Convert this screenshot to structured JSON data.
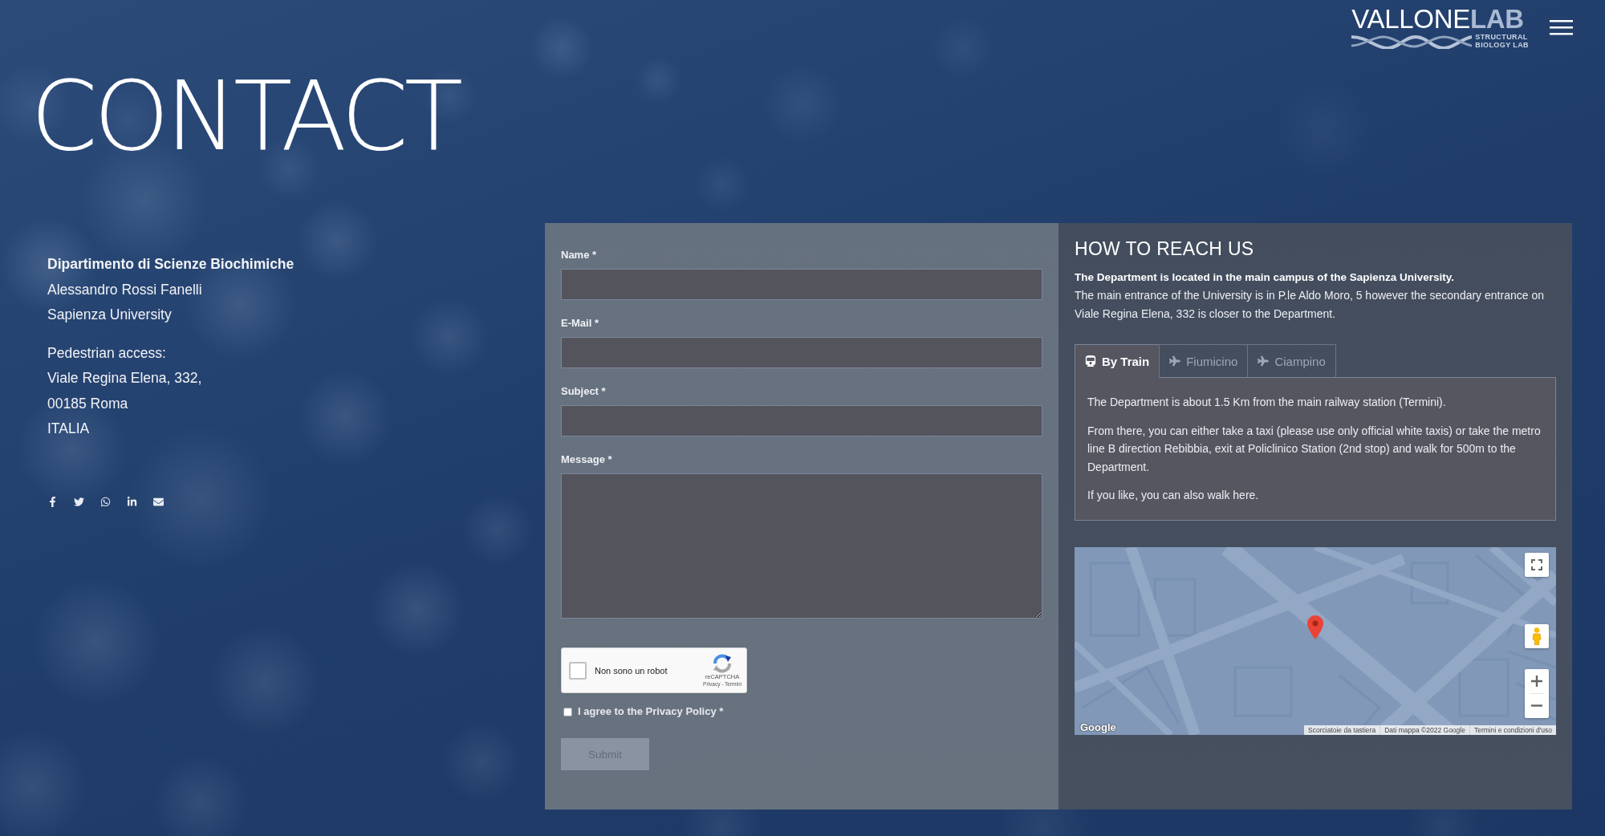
{
  "header": {
    "logo": {
      "wordmark": "VALLONE**LAB**",
      "tagline": [
        "STRUCTURAL",
        "BIOLOGY LAB"
      ]
    }
  },
  "page_title": "CONTACT",
  "address": {
    "heading": "Dipartimento di Scienze Biochimiche",
    "lines": [
      "Alessandro Rossi Fanelli",
      "Sapienza University"
    ]
  },
  "access": {
    "lines": [
      "Pedestrian access:",
      "Viale Regina Elena, 332,",
      "00185 Roma",
      "ITALIA"
    ]
  },
  "form": {
    "fields": [
      {
        "label": "Name *",
        "kind": "input"
      },
      {
        "label": "E-Mail *",
        "kind": "input"
      },
      {
        "label": "Subject *",
        "kind": "input"
      },
      {
        "label": "Message *",
        "kind": "textarea"
      }
    ],
    "recaptcha": {
      "label": "Non sono un robot",
      "checked": false,
      "brand": "reCAPTCHA",
      "links": "Privacy - Termini"
    },
    "consent": {
      "label": "I agree to the Privacy Policy *",
      "checked": false
    },
    "submit": {
      "label": "Submit",
      "disabled": true
    }
  },
  "directions": {
    "title": "HOW TO REACH US",
    "lead": "The Department is located in the main campus of the Sapienza University.",
    "text": "The main entrance of the University is in P.le Aldo Moro, 5 however the secondary entrance on Viale Regina Elena, 332 is closer to the Department.",
    "tabs": [
      {
        "label": "By Train",
        "kind": "train",
        "selected": true
      },
      {
        "label": "Fiumicino",
        "kind": "plane",
        "selected": false
      },
      {
        "label": "Ciampino",
        "kind": "plane",
        "selected": false
      }
    ],
    "tab_panel": {
      "paragraphs": [
        "The Department is about 1.5 Km from the main railway station (Termini).",
        "From there, you can either take a taxi (please use only official white taxis) or take the metro line B direction Rebibbia, exit at Policlinico Station (2nd stop) and walk for 500m to the Department.",
        "If you like, you can also walk here."
      ]
    },
    "map": {
      "logo": "Google",
      "attribution": [
        "Scorciatoie da tastiera",
        "Dati mappa ©2022 Google",
        "Termini e condizioni d'uso"
      ]
    }
  }
}
